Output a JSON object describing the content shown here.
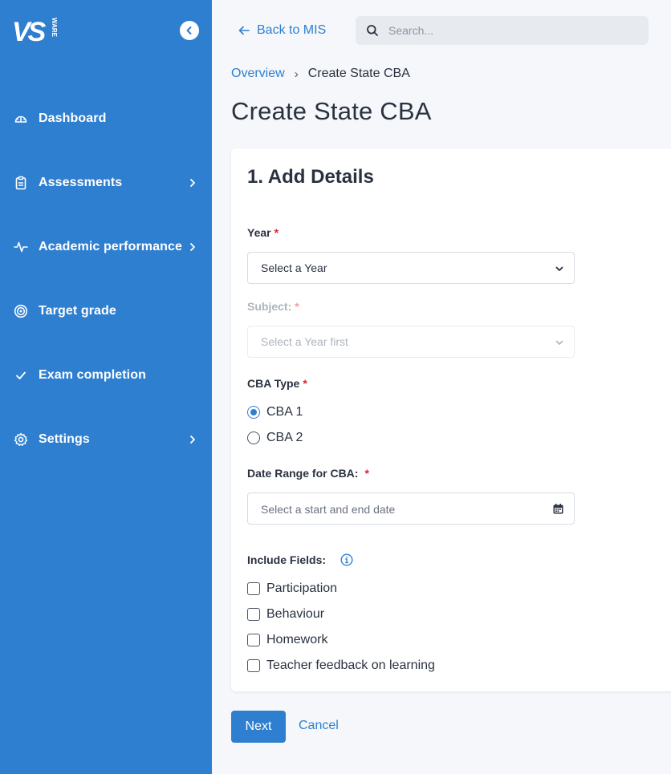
{
  "brand": {
    "logo_text": "VS",
    "logo_subtext": "WARE",
    "accent": "#2f7fd1"
  },
  "sidebar": {
    "collapse_icon": "chevron-left-icon",
    "items": [
      {
        "label": "Dashboard",
        "icon": "gauge-icon",
        "has_chevron": false
      },
      {
        "label": "Assessments",
        "icon": "clipboard-icon",
        "has_chevron": true
      },
      {
        "label": "Academic performance",
        "icon": "activity-icon",
        "has_chevron": true
      },
      {
        "label": "Target grade",
        "icon": "target-icon",
        "has_chevron": false
      },
      {
        "label": "Exam completion",
        "icon": "check-icon",
        "has_chevron": false
      },
      {
        "label": "Settings",
        "icon": "gear-icon",
        "has_chevron": true
      }
    ]
  },
  "topbar": {
    "back_label": "Back to MIS",
    "search_placeholder": "Search..."
  },
  "breadcrumb": {
    "items": [
      "Overview",
      "Create State CBA"
    ],
    "separator": "›"
  },
  "page": {
    "title": "Create State CBA"
  },
  "form": {
    "section_title": "1. Add Details",
    "year": {
      "label": "Year",
      "required_mark": "*",
      "value": "Select a Year"
    },
    "subject": {
      "label": "Subject:",
      "required_mark": "*",
      "value": "Select a Year first"
    },
    "cba_type": {
      "label": "CBA Type",
      "required_mark": "*",
      "options": [
        "CBA 1",
        "CBA 2"
      ],
      "selected": "CBA 1"
    },
    "date_range": {
      "label": "Date Range for CBA:",
      "required_mark": "*",
      "placeholder": "Select a start and end date"
    },
    "include_fields": {
      "label": "Include Fields:",
      "options": [
        "Participation",
        "Behaviour",
        "Homework",
        "Teacher feedback on learning"
      ]
    }
  },
  "actions": {
    "next_label": "Next",
    "cancel_label": "Cancel"
  }
}
